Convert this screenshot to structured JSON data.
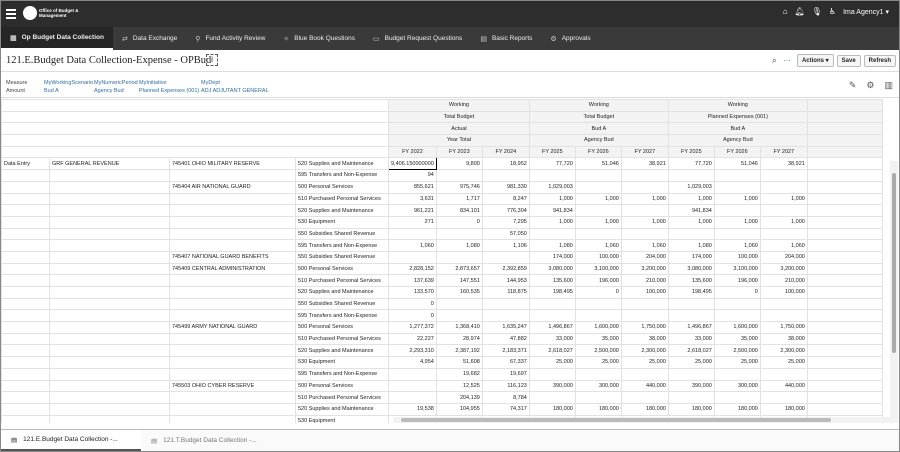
{
  "header": {
    "logo_text": "Office of Budget & Management",
    "user": "Ima Agency1",
    "icons": [
      "home-icon",
      "bell-icon",
      "microphone-icon",
      "accessibility-icon"
    ]
  },
  "nav": {
    "tabs": [
      {
        "label": "Op Budget Data Collection",
        "icon": "table-icon",
        "active": true
      },
      {
        "label": "Data Exchange",
        "icon": "arrows-icon"
      },
      {
        "label": "Fund Activity Review",
        "icon": "person-icon"
      },
      {
        "label": "Blue Book Questions",
        "icon": "wand-icon"
      },
      {
        "label": "Budget Request Questions",
        "icon": "chat-icon"
      },
      {
        "label": "Basic Reports",
        "icon": "report-icon"
      },
      {
        "label": "Approvals",
        "icon": "gear-icon"
      }
    ]
  },
  "page": {
    "title": "121.E.Budget Data Collection-Expense - OPBud",
    "actions_label": "Actions ▾",
    "save_label": "Save",
    "refresh_label": "Refresh"
  },
  "pov": [
    {
      "label": "Measure",
      "value": "Amount"
    },
    {
      "label": "MyWorkingScenario",
      "value": "Bud A"
    },
    {
      "label": "MyNumericPeriod",
      "value": "Agency Bud"
    },
    {
      "label": "MyInitiative",
      "value": "Planned Expenses (001)"
    },
    {
      "label": "MyDept",
      "value": "ADJ ADJUTANT GENERAL"
    }
  ],
  "grid": {
    "headers": {
      "row1": [
        "Working",
        "Working",
        "Working"
      ],
      "row2": [
        "Total Budget",
        "Total Budget",
        "Planned Expenses (001)"
      ],
      "row3": [
        "Actual",
        "Bud A",
        "Bud A"
      ],
      "row4": [
        "Year Total",
        "Agency Bud",
        "Agency Bud"
      ],
      "years": [
        "FY 2022",
        "FY 2023",
        "FY 2024",
        "FY 2025",
        "FY 2026",
        "FY 2027",
        "FY 2025",
        "FY 2026",
        "FY 2027"
      ]
    },
    "row_label_1": "Data Entry",
    "row_label_2": "GRF GENERAL REVENUE",
    "rows": [
      {
        "org": "745401 OHIO MILITARY RESERVE",
        "acct": "520 Supplies and Maintenance",
        "v": [
          "9,406.150000000",
          "9,800",
          "18,952",
          "77,720",
          "51,046",
          "38,921",
          "77,720",
          "51,046",
          "38,921"
        ]
      },
      {
        "org": "",
        "acct": "595 Transfers and Non-Expense",
        "v": [
          "94",
          "",
          "",
          "",
          "",
          "",
          "",
          "",
          ""
        ]
      },
      {
        "org": "745404 AIR NATIONAL GUARD",
        "acct": "500 Personal Services",
        "v": [
          "855,621",
          "975,746",
          "981,330",
          "1,029,003",
          "",
          "",
          "1,029,003",
          "",
          ""
        ]
      },
      {
        "org": "",
        "acct": "510 Purchased Personal Services",
        "v": [
          "3,631",
          "1,717",
          "8,247",
          "1,000",
          "1,000",
          "1,000",
          "1,000",
          "1,000",
          "1,000"
        ]
      },
      {
        "org": "",
        "acct": "520 Supplies and Maintenance",
        "v": [
          "961,221",
          "834,101",
          "776,304",
          "941,834",
          "",
          "",
          "941,834",
          "",
          ""
        ]
      },
      {
        "org": "",
        "acct": "530 Equipment",
        "v": [
          "271",
          "0",
          "7,295",
          "1,000",
          "1,000",
          "1,000",
          "1,000",
          "1,000",
          "1,000"
        ]
      },
      {
        "org": "",
        "acct": "550 Subsidies Shared Revenue",
        "v": [
          "",
          "",
          "57,050",
          "",
          "",
          "",
          "",
          "",
          ""
        ]
      },
      {
        "org": "",
        "acct": "595 Transfers and Non-Expense",
        "v": [
          "1,060",
          "1,080",
          "1,106",
          "1,080",
          "1,060",
          "1,060",
          "1,080",
          "1,060",
          "1,060"
        ]
      },
      {
        "org": "745407 NATIONAL GUARD BENEFITS",
        "acct": "550 Subsidies Shared Revenue",
        "v": [
          "",
          "",
          "",
          "174,000",
          "100,000",
          "204,000",
          "174,000",
          "100,000",
          "204,000"
        ]
      },
      {
        "org": "745409 CENTRAL ADMINISTRATION",
        "acct": "500 Personal Services",
        "v": [
          "2,828,152",
          "2,873,657",
          "2,392,859",
          "3,080,000",
          "3,100,000",
          "3,200,000",
          "3,080,000",
          "3,100,000",
          "3,200,000"
        ]
      },
      {
        "org": "",
        "acct": "510 Purchased Personal Services",
        "v": [
          "137,639",
          "147,551",
          "144,953",
          "135,600",
          "196,000",
          "210,000",
          "135,600",
          "196,000",
          "210,000"
        ]
      },
      {
        "org": "",
        "acct": "520 Supplies and Maintenance",
        "v": [
          "133,570",
          "160,535",
          "118,875",
          "198,495",
          "0",
          "100,000",
          "198,495",
          "0",
          "100,000"
        ]
      },
      {
        "org": "",
        "acct": "550 Subsidies Shared Revenue",
        "v": [
          "0",
          "",
          "",
          "",
          "",
          "",
          "",
          "",
          ""
        ]
      },
      {
        "org": "",
        "acct": "595 Transfers and Non-Expense",
        "v": [
          "0",
          "",
          "",
          "",
          "",
          "",
          "",
          "",
          ""
        ]
      },
      {
        "org": "745499 ARMY NATIONAL GUARD",
        "acct": "500 Personal Services",
        "v": [
          "1,277,372",
          "1,368,410",
          "1,635,247",
          "1,496,867",
          "1,600,000",
          "1,750,000",
          "1,496,867",
          "1,600,000",
          "1,750,000"
        ]
      },
      {
        "org": "",
        "acct": "510 Purchased Personal Services",
        "v": [
          "22,227",
          "28,974",
          "47,882",
          "33,000",
          "35,000",
          "38,000",
          "33,000",
          "35,000",
          "38,000"
        ]
      },
      {
        "org": "",
        "acct": "520 Supplies and Maintenance",
        "v": [
          "2,293,310",
          "2,387,192",
          "2,183,371",
          "2,618,027",
          "2,500,000",
          "2,300,000",
          "2,618,027",
          "2,500,000",
          "2,300,000"
        ]
      },
      {
        "org": "",
        "acct": "530 Equipment",
        "v": [
          "4,954",
          "51,608",
          "67,337",
          "25,000",
          "25,000",
          "25,000",
          "25,000",
          "25,000",
          "25,000"
        ]
      },
      {
        "org": "",
        "acct": "595 Transfers and Non-Expense",
        "v": [
          "",
          "19,682",
          "19,697",
          "",
          "",
          "",
          "",
          "",
          ""
        ]
      },
      {
        "org": "745503 OHIO CYBER RESERVE",
        "acct": "500 Personal Services",
        "v": [
          "",
          "12,525",
          "116,123",
          "390,000",
          "300,000",
          "440,000",
          "390,000",
          "300,000",
          "440,000"
        ]
      },
      {
        "org": "",
        "acct": "510 Purchased Personal Services",
        "v": [
          "",
          "204,139",
          "8,784",
          "",
          "",
          "",
          "",
          "",
          ""
        ]
      },
      {
        "org": "",
        "acct": "520 Supplies and Maintenance",
        "v": [
          "19,538",
          "104,955",
          "74,317",
          "180,000",
          "180,000",
          "180,000",
          "180,000",
          "180,000",
          "180,000"
        ]
      },
      {
        "org": "",
        "acct": "530 Equipment",
        "v": [
          "",
          "",
          "",
          "",
          "",
          "",
          "",
          "",
          ""
        ]
      }
    ]
  },
  "bottom_tabs": [
    {
      "label": "121.E.Budget Data Collection -...",
      "active": true
    },
    {
      "label": "121.T.Budget Data Collection -...",
      "active": false
    }
  ]
}
